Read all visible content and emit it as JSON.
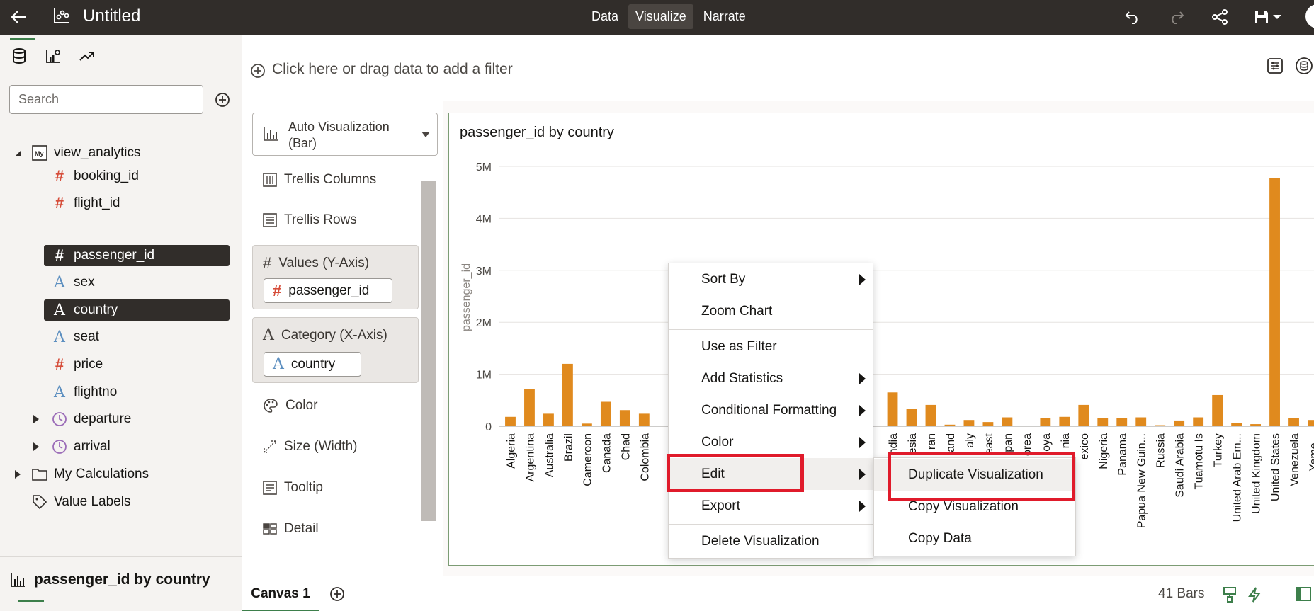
{
  "topbar": {
    "title": "Untitled",
    "tabs": [
      {
        "label": "Data"
      },
      {
        "label": "Visualize",
        "active": true
      },
      {
        "label": "Narrate"
      }
    ]
  },
  "leftpanel": {
    "search_placeholder": "Search",
    "tree": {
      "source": {
        "label": "view_analytics",
        "badge": "My"
      },
      "fields": [
        {
          "label": "booking_id",
          "type": "number"
        },
        {
          "label": "flight_id",
          "type": "number"
        },
        {
          "label": "passenger_id",
          "type": "number",
          "selected": true
        },
        {
          "label": "sex",
          "type": "text"
        },
        {
          "label": "country",
          "type": "text",
          "selected": true
        },
        {
          "label": "seat",
          "type": "text"
        },
        {
          "label": "price",
          "type": "number"
        },
        {
          "label": "flightno",
          "type": "text"
        },
        {
          "label": "departure",
          "type": "time"
        },
        {
          "label": "arrival",
          "type": "time"
        }
      ],
      "my_calculations": "My Calculations",
      "value_labels": "Value Labels"
    },
    "bottom_title": "passenger_id by country"
  },
  "filterbar": {
    "text": "Click here or drag data to add a filter"
  },
  "grammar": {
    "viz_type": "Auto Visualization (Bar)",
    "trellis_columns": "Trellis Columns",
    "trellis_rows": "Trellis Rows",
    "values_header": "Values (Y-Axis)",
    "values_pill": "passenger_id",
    "category_header": "Category (X-Axis)",
    "category_pill": "country",
    "color": "Color",
    "size": "Size (Width)",
    "tooltip": "Tooltip",
    "detail": "Detail"
  },
  "viz": {
    "title": "passenger_id by country"
  },
  "chart_data": {
    "type": "bar",
    "title": "passenger_id by country",
    "ylabel": "passenger_id",
    "xlabel": "",
    "ylim": [
      0,
      5000000
    ],
    "yticks": [
      {
        "value": 0,
        "label": "0"
      },
      {
        "value": 1000000,
        "label": "1M"
      },
      {
        "value": 2000000,
        "label": "2M"
      },
      {
        "value": 3000000,
        "label": "3M"
      },
      {
        "value": 4000000,
        "label": "4M"
      },
      {
        "value": 5000000,
        "label": "5M"
      }
    ],
    "grid": true,
    "color": "#e08a1e",
    "categories": [
      "Algeria",
      "Argentina",
      "Australia",
      "Brazil",
      "Cameroon",
      "Canada",
      "Chad",
      "Colombia",
      "",
      "",
      "",
      "",
      "",
      "",
      "",
      "",
      "",
      "",
      "",
      "",
      "ndia",
      "esia",
      "ran",
      "and",
      "aly",
      "east",
      "pan",
      "orea",
      "oya",
      "nia",
      "exico",
      "Nigeria",
      "Panama",
      "Papua New Guin...",
      "Russia",
      "Saudi Arabia",
      "Tuamotu Is",
      "Turkey",
      "United Arab Em...",
      "United Kingdom",
      "United States",
      "Venezuela",
      "Yeme..."
    ],
    "values": [
      180000,
      720000,
      240000,
      1200000,
      50000,
      470000,
      310000,
      240000,
      0,
      0,
      0,
      0,
      0,
      0,
      0,
      0,
      0,
      0,
      0,
      0,
      650000,
      330000,
      410000,
      30000,
      120000,
      80000,
      170000,
      10000,
      160000,
      180000,
      410000,
      160000,
      160000,
      170000,
      20000,
      110000,
      170000,
      600000,
      60000,
      40000,
      4780000,
      150000,
      120000
    ]
  },
  "context_menu": {
    "items": [
      {
        "label": "Sort By",
        "submenu": true
      },
      {
        "label": "Zoom Chart"
      },
      {
        "label": "Use as Filter"
      },
      {
        "label": "Add Statistics",
        "submenu": true
      },
      {
        "label": "Conditional Formatting",
        "submenu": true
      },
      {
        "label": "Color",
        "submenu": true
      },
      {
        "label": "Edit",
        "submenu": true,
        "highlighted": true
      },
      {
        "label": "Export",
        "submenu": true
      },
      {
        "label": "Delete Visualization"
      }
    ]
  },
  "sub_menu": {
    "items": [
      {
        "label": "Duplicate Visualization",
        "highlighted": true
      },
      {
        "label": "Copy Visualization"
      },
      {
        "label": "Copy Data"
      }
    ]
  },
  "bottombar": {
    "canvas_tab": "Canvas 1",
    "bars_count": "41 Bars"
  },
  "colors": {
    "topbar": "#312d2a",
    "accent_green": "#3d7f4b",
    "bar": "#e08a1e",
    "highlight_red": "#e01b2b"
  }
}
